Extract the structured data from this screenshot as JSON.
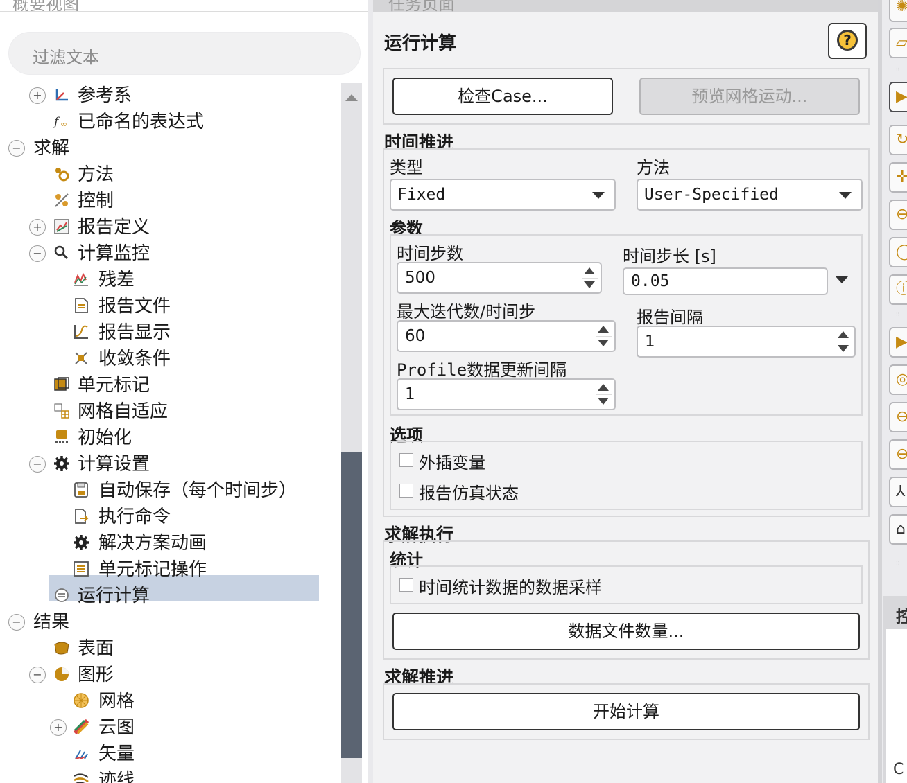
{
  "left_panel": {
    "cut_title": "概要视图",
    "filter_placeholder": "过滤文本",
    "tree": [
      {
        "label": "参考系",
        "name": "tree-item-reference-frames",
        "icon": "axes-icon",
        "toggle": "+",
        "level": 1
      },
      {
        "label": "已命名的表达式",
        "name": "tree-item-named-expressions",
        "icon": "function-icon",
        "toggle": "",
        "level": 1
      },
      {
        "label": "求解",
        "name": "tree-item-solution",
        "icon": "",
        "toggle": "−",
        "level": 0
      },
      {
        "label": "方法",
        "name": "tree-item-methods",
        "icon": "methods-icon",
        "toggle": "",
        "level": 1
      },
      {
        "label": "控制",
        "name": "tree-item-controls",
        "icon": "controls-icon",
        "toggle": "",
        "level": 1
      },
      {
        "label": "报告定义",
        "name": "tree-item-report-definitions",
        "icon": "report-definitions-icon",
        "toggle": "+",
        "level": 1
      },
      {
        "label": "计算监控",
        "name": "tree-item-monitors",
        "icon": "monitor-magnifier-icon",
        "toggle": "−",
        "level": 1
      },
      {
        "label": "残差",
        "name": "tree-item-residuals",
        "icon": "residuals-chart-icon",
        "toggle": "",
        "level": 2
      },
      {
        "label": "报告文件",
        "name": "tree-item-report-files",
        "icon": "report-file-icon",
        "toggle": "",
        "level": 2
      },
      {
        "label": "报告显示",
        "name": "tree-item-report-plots",
        "icon": "report-plot-icon",
        "toggle": "",
        "level": 2
      },
      {
        "label": "收敛条件",
        "name": "tree-item-convergence-conditions",
        "icon": "convergence-icon",
        "toggle": "",
        "level": 2
      },
      {
        "label": "单元标记",
        "name": "tree-item-cell-registers",
        "icon": "cell-register-icon",
        "toggle": "",
        "level": 1
      },
      {
        "label": "网格自适应",
        "name": "tree-item-mesh-adaption",
        "icon": "mesh-adaption-icon",
        "toggle": "",
        "level": 1
      },
      {
        "label": "初始化",
        "name": "tree-item-initialization",
        "icon": "initialization-icon",
        "toggle": "",
        "level": 1
      },
      {
        "label": "计算设置",
        "name": "tree-item-calculation-activities",
        "icon": "gear-icon",
        "toggle": "−",
        "level": 1
      },
      {
        "label": "自动保存（每个时间步）",
        "name": "tree-item-autosave",
        "icon": "save-icon",
        "toggle": "",
        "level": 2
      },
      {
        "label": "执行命令",
        "name": "tree-item-execute-commands",
        "icon": "execute-command-icon",
        "toggle": "",
        "level": 2
      },
      {
        "label": "解决方案动画",
        "name": "tree-item-solution-animations",
        "icon": "gear-icon",
        "toggle": "",
        "level": 2
      },
      {
        "label": "单元标记操作",
        "name": "tree-item-cell-register-operations",
        "icon": "register-operations-icon",
        "toggle": "",
        "level": 2
      },
      {
        "label": "运行计算",
        "name": "tree-item-run-calculation",
        "icon": "run-calculation-icon",
        "toggle": "",
        "level": 1,
        "selected": true
      },
      {
        "label": "结果",
        "name": "tree-item-results",
        "icon": "",
        "toggle": "−",
        "level": 0
      },
      {
        "label": "表面",
        "name": "tree-item-surfaces",
        "icon": "surface-icon",
        "toggle": "",
        "level": 1
      },
      {
        "label": "图形",
        "name": "tree-item-graphics",
        "icon": "graphics-pie-icon",
        "toggle": "−",
        "level": 1
      },
      {
        "label": "网格",
        "name": "tree-item-mesh",
        "icon": "mesh-icon",
        "toggle": "",
        "level": 2
      },
      {
        "label": "云图",
        "name": "tree-item-contours",
        "icon": "contours-icon",
        "toggle": "+",
        "level": 2
      },
      {
        "label": "矢量",
        "name": "tree-item-vectors",
        "icon": "vectors-icon",
        "toggle": "",
        "level": 2
      },
      {
        "label": "迹线",
        "name": "tree-item-pathlines",
        "icon": "pathlines-icon",
        "toggle": "",
        "level": 2
      }
    ]
  },
  "task_panel": {
    "cut_title": "任务页面",
    "title": "运行计算",
    "check_case_label": "检查Case...",
    "preview_mesh_motion_label": "预览网格运动...",
    "time_advancement": {
      "section": "时间推进",
      "type_label": "类型",
      "type_value": "Fixed",
      "method_label": "方法",
      "method_value": "User-Specified"
    },
    "parameters": {
      "section": "参数",
      "time_steps_label": "时间步数",
      "time_steps_value": "500",
      "time_step_size_label": "时间步长 [s]",
      "time_step_size_value": "0.05",
      "max_iter_label": "最大迭代数/时间步",
      "max_iter_value": "60",
      "report_interval_label": "报告间隔",
      "report_interval_value": "1",
      "profile_interval_label": "Profile数据更新间隔",
      "profile_interval_value": "1"
    },
    "options": {
      "section": "选项",
      "extrapolate_label": "外插变量",
      "report_status_label": "报告仿真状态"
    },
    "solution_processing": {
      "section": "求解执行",
      "statistics_label": "统计",
      "sampling_label": "时间统计数据的数据采样",
      "data_file_quantities_label": "数据文件数量..."
    },
    "solution_advancement": {
      "section": "求解推进",
      "calculate_label": "开始计算"
    }
  },
  "right_toolbar": {
    "pane_cut_title": "控",
    "pane_cut_text": "C"
  }
}
